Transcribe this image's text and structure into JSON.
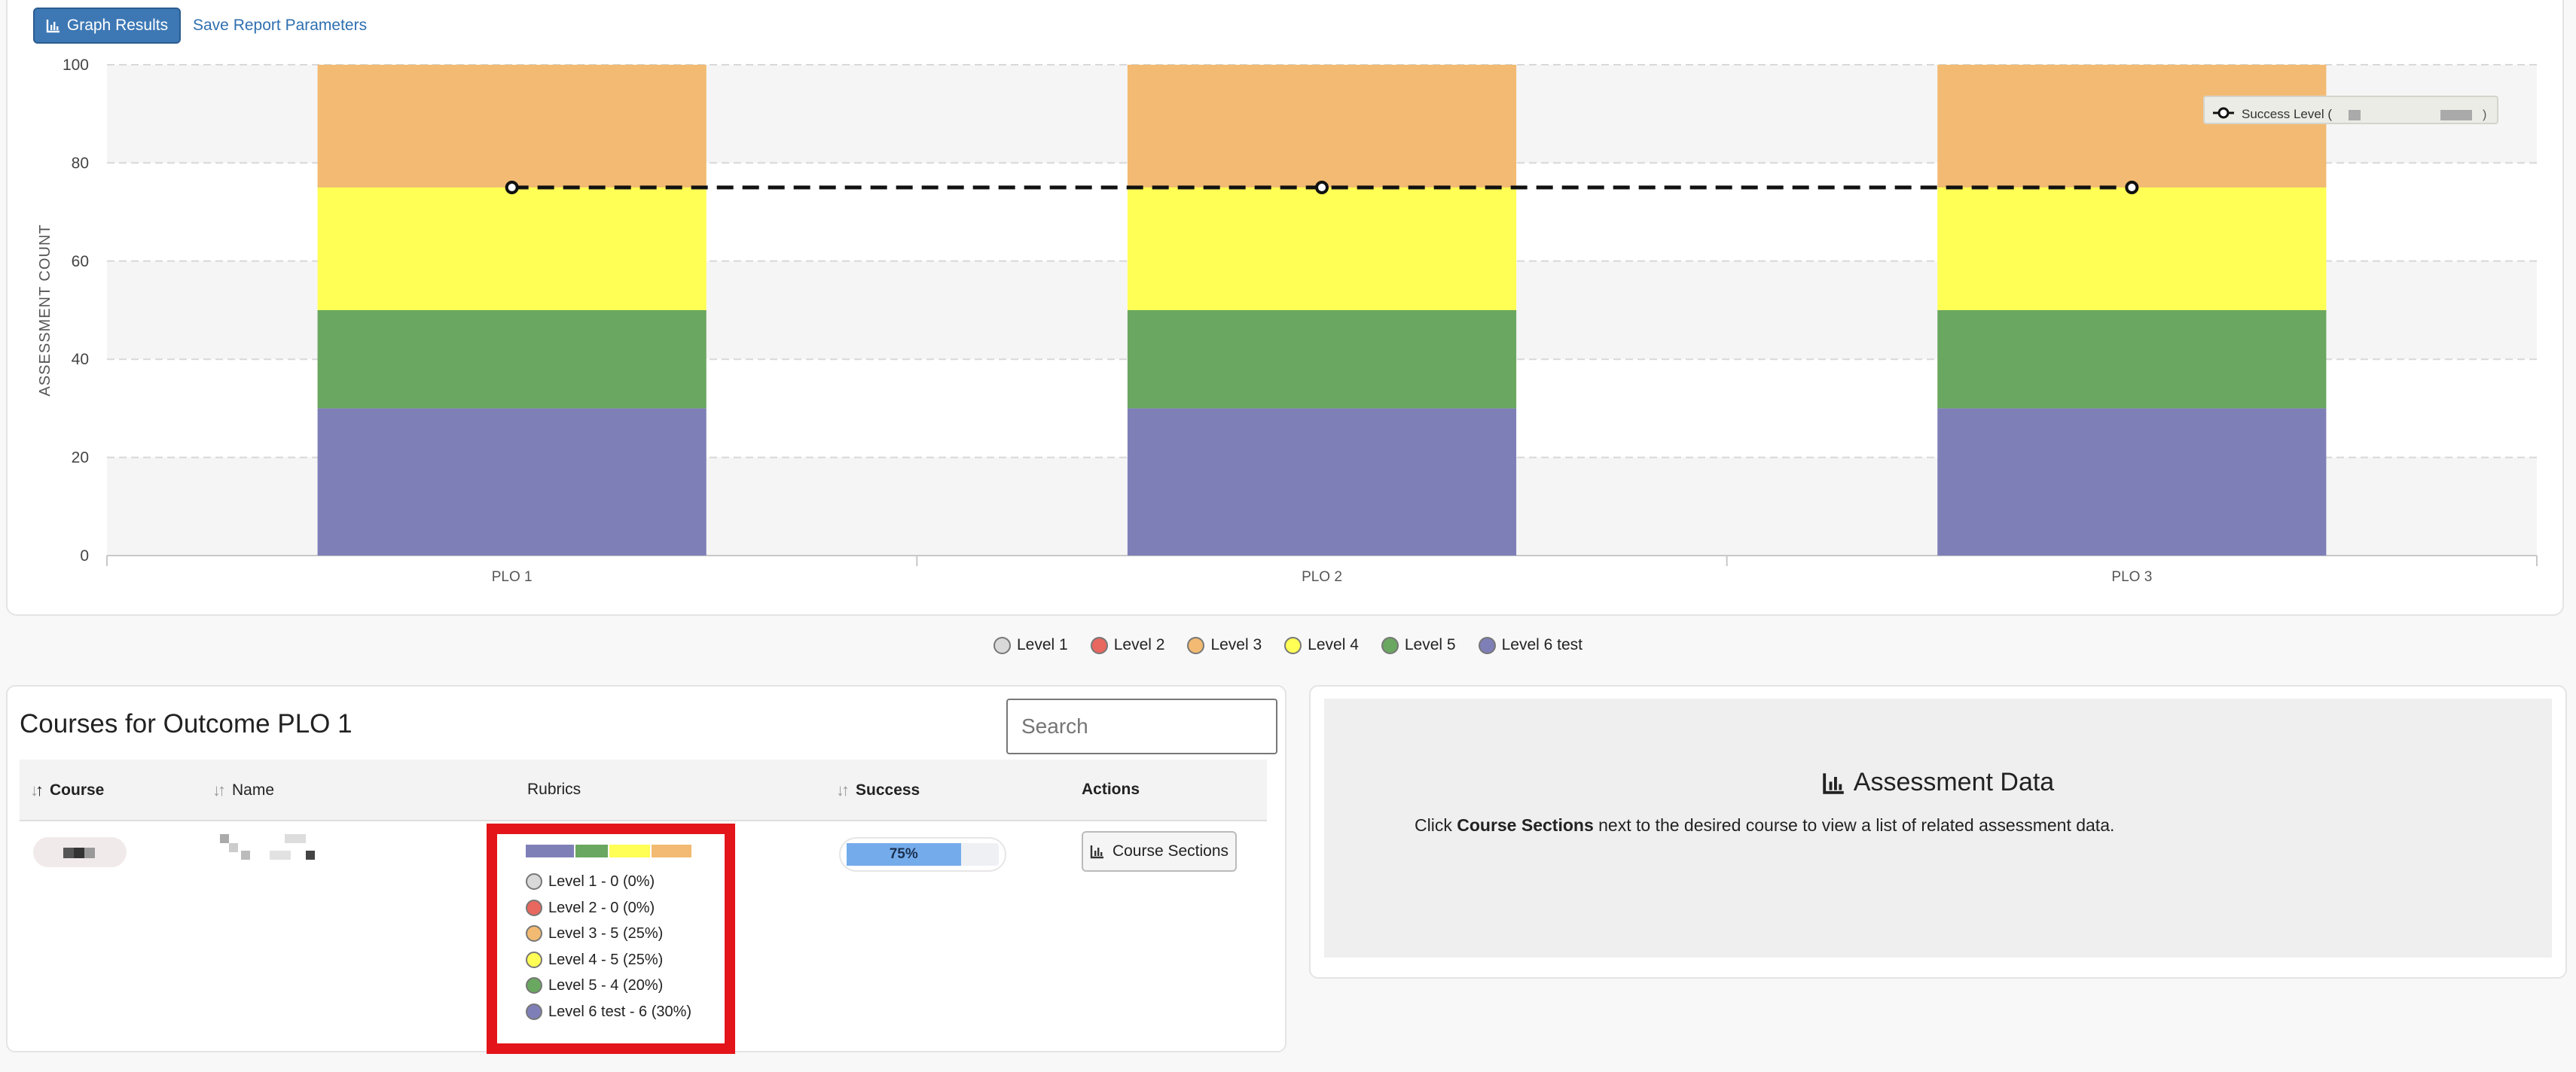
{
  "toolbar": {
    "graph_button_label": "Graph Results",
    "save_link_label": "Save Report Parameters"
  },
  "chart_data": {
    "type": "bar",
    "stacked": true,
    "categories": [
      "PLO 1",
      "PLO 2",
      "PLO 3"
    ],
    "ylabel": "ASSESSMENT COUNT",
    "ylim": [
      0,
      100
    ],
    "yticks": [
      0,
      20,
      40,
      60,
      80,
      100
    ],
    "grid": true,
    "series": [
      {
        "name": "Level 1",
        "color": "#d9d9d9",
        "values": [
          0,
          0,
          0
        ]
      },
      {
        "name": "Level 2",
        "color": "#e8675f",
        "values": [
          0,
          0,
          0
        ]
      },
      {
        "name": "Level 6 test",
        "color": "#7f7fb8",
        "values": [
          30,
          30,
          30
        ]
      },
      {
        "name": "Level 5",
        "color": "#6aa760",
        "values": [
          20,
          20,
          20
        ]
      },
      {
        "name": "Level 4",
        "color": "#ffff55",
        "values": [
          25,
          25,
          25
        ]
      },
      {
        "name": "Level 3",
        "color": "#f2ba72",
        "values": [
          25,
          25,
          25
        ]
      }
    ],
    "success_line": {
      "name": "Success Level (",
      "values": [
        75,
        75,
        75
      ]
    }
  },
  "legend": [
    {
      "label": "Level 1",
      "color": "#d9d9d9"
    },
    {
      "label": "Level 2",
      "color": "#e8675f"
    },
    {
      "label": "Level 3",
      "color": "#f2ba72"
    },
    {
      "label": "Level 4",
      "color": "#ffff55"
    },
    {
      "label": "Level 5",
      "color": "#6aa760"
    },
    {
      "label": "Level 6 test",
      "color": "#7f7fb8"
    }
  ],
  "courses": {
    "title": "Courses for Outcome PLO 1",
    "search_placeholder": "Search",
    "columns": {
      "course": "Course",
      "name": "Name",
      "rubrics": "Rubrics",
      "success": "Success",
      "actions": "Actions"
    },
    "row": {
      "rubric_levels": [
        {
          "label": "Level 1 - 0 (0%)",
          "color": "#d9d9d9",
          "percent": 0
        },
        {
          "label": "Level 2 - 0 (0%)",
          "color": "#e8675f",
          "percent": 0
        },
        {
          "label": "Level 3 - 5 (25%)",
          "color": "#f2ba72",
          "percent": 25
        },
        {
          "label": "Level 4 - 5 (25%)",
          "color": "#ffff55",
          "percent": 25
        },
        {
          "label": "Level 5 - 4 (20%)",
          "color": "#6aa760",
          "percent": 20
        },
        {
          "label": "Level 6 test - 6 (30%)",
          "color": "#7f7fb8",
          "percent": 30
        }
      ],
      "success_label": "75%",
      "success_value": 75,
      "action_label": "Course Sections"
    }
  },
  "assessment": {
    "title": "Assessment Data",
    "text_before": "Click ",
    "text_bold": "Course Sections",
    "text_after": " next to the desired course to view a list of related assessment data."
  }
}
